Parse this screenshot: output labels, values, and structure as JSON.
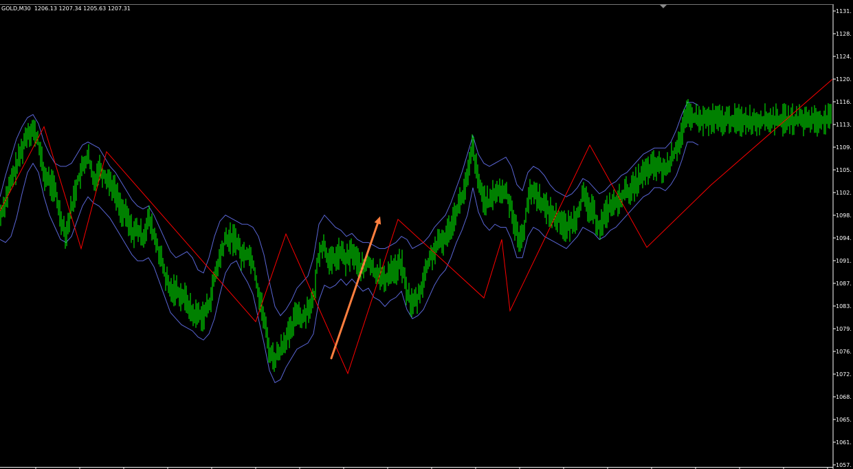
{
  "header": {
    "symbol": "GOLD,M30",
    "ohlc": "1206.13 1207.34 1205.63 1207.31"
  },
  "colors": {
    "background": "#000000",
    "candles": "#00ff00",
    "bands": "#5a66d6",
    "zigzag": "#ff0000",
    "arrow": "#ff7f3f",
    "axis": "#ffffff"
  },
  "chart_data": {
    "type": "line",
    "title": "GOLD,M30",
    "y_axis": {
      "ticks": [
        "1131.",
        "1128.",
        "1124.",
        "1120.",
        "1116.",
        "1113.",
        "1109.",
        "1105.",
        "1102.",
        "1098.",
        "1094.",
        "1091.",
        "1087.",
        "1083.",
        "1079.",
        "1076.",
        "1072.",
        "1068.",
        "1065.",
        "1061.",
        "1057."
      ],
      "ylim": [
        1057,
        1131.5
      ],
      "position": "right"
    },
    "x": [
      0,
      8,
      16,
      24,
      32,
      40,
      48,
      56,
      64,
      72,
      80,
      88,
      96,
      104,
      112,
      120,
      128,
      136,
      144,
      152,
      160,
      168,
      176,
      184,
      192,
      200,
      208,
      216,
      224,
      232,
      240,
      248,
      256,
      264,
      272,
      280,
      288,
      296,
      304,
      312,
      320,
      328,
      336,
      344,
      352,
      360,
      368,
      376,
      384,
      392,
      400,
      408,
      416,
      424,
      432,
      440,
      448,
      456,
      464,
      472,
      480,
      488,
      496,
      504,
      512,
      520,
      528,
      536,
      544,
      552,
      560,
      568,
      576,
      584,
      592,
      600,
      608,
      616,
      624,
      632,
      640,
      648,
      656,
      664,
      672,
      680,
      688,
      696,
      704,
      712,
      720,
      728,
      736,
      744,
      752,
      760,
      768,
      776,
      784,
      792,
      800,
      808,
      816,
      824,
      832,
      840,
      848,
      856,
      864,
      872,
      880,
      888,
      896,
      904,
      912,
      920,
      928,
      936,
      944,
      952,
      960,
      968,
      976,
      984,
      992,
      1000,
      1008,
      1016,
      1024,
      1032,
      1040,
      1048,
      1056,
      1064,
      1072,
      1080,
      1088,
      1096,
      1104,
      1112,
      1120,
      1128,
      1136,
      1144,
      1152,
      1160,
      1168,
      1176,
      1184,
      1192,
      1200,
      1208
    ],
    "series": [
      {
        "kind": "price",
        "values": [
          1097.7,
          1100.5,
          1103.3,
          1106.0,
          1108.8,
          1111.7,
          1112.0,
          1110.0,
          1104.5,
          1103.6,
          1102.1,
          1097.8,
          1094.9,
          1099.1,
          1103.3,
          1105.6,
          1107.9,
          1103.2,
          1105.9,
          1104.5,
          1103.6,
          1101.8,
          1099.0,
          1097.8,
          1095.3,
          1095.5,
          1094.3,
          1097.5,
          1094.6,
          1091.8,
          1088.1,
          1085.4,
          1085.9,
          1084.8,
          1084.0,
          1081.6,
          1081.8,
          1081.5,
          1083.2,
          1087.5,
          1091.0,
          1094.0,
          1094.1,
          1094.0,
          1091.2,
          1092.0,
          1090.4,
          1085.4,
          1081.1,
          1075.6,
          1074.3,
          1076.0,
          1077.9,
          1078.9,
          1082.6,
          1080.8,
          1082.9,
          1083.6,
          1092.2,
          1093.0,
          1090.0,
          1091.0,
          1091.9,
          1090.4,
          1092.1,
          1090.3,
          1089.0,
          1090.5,
          1088.6,
          1088.6,
          1086.9,
          1089.3,
          1088.9,
          1090.2,
          1085.2,
          1083.4,
          1084.3,
          1087.4,
          1090.5,
          1092.3,
          1093.4,
          1094.3,
          1096.4,
          1098.9,
          1100.8,
          1103.9,
          1109.5,
          1103.1,
          1100.8,
          1099.7,
          1101.9,
          1101.7,
          1101.8,
          1099.3,
          1094.9,
          1093.8,
          1100.7,
          1102.0,
          1100.9,
          1099.3,
          1098.6,
          1097.5,
          1097.3,
          1095.7,
          1096.6,
          1098.3,
          1101.1,
          1099.3,
          1098.3,
          1096.0,
          1097.9,
          1099.7,
          1099.6,
          1101.1,
          1101.8,
          1102.2,
          1103.7,
          1104.7,
          1105.4,
          1106.1,
          1105.9,
          1105.2,
          1107.0,
          1109.0,
          1111.6,
          1114.4,
          1114.0,
          1113.6
        ]
      },
      {
        "kind": "upper-band",
        "values": [
          1101.0,
          1104.5,
          1107.5,
          1110.5,
          1112.5,
          1114.0,
          1114.5,
          1113.0,
          1110.0,
          1108.0,
          1106.5,
          1106.0,
          1106.0,
          1106.5,
          1108.0,
          1109.5,
          1110.0,
          1109.5,
          1109.0,
          1107.5,
          1106.0,
          1105.0,
          1103.5,
          1102.0,
          1100.5,
          1099.5,
          1099.0,
          1099.5,
          1098.0,
          1096.0,
          1094.0,
          1092.0,
          1091.0,
          1091.5,
          1092.0,
          1091.0,
          1089.0,
          1088.5,
          1091.0,
          1094.5,
          1097.0,
          1098.0,
          1097.5,
          1097.0,
          1096.5,
          1096.5,
          1096.0,
          1094.5,
          1091.5,
          1087.0,
          1083.0,
          1081.5,
          1082.5,
          1084.0,
          1086.0,
          1087.0,
          1088.0,
          1091.0,
          1096.5,
          1098.0,
          1097.0,
          1096.0,
          1095.5,
          1094.5,
          1095.0,
          1094.0,
          1093.5,
          1093.5,
          1093.0,
          1092.5,
          1092.5,
          1093.0,
          1093.5,
          1094.5,
          1094.0,
          1092.5,
          1093.0,
          1093.5,
          1094.5,
          1096.0,
          1097.0,
          1098.0,
          1100.0,
          1102.5,
          1105.0,
          1108.0,
          1111.0,
          1108.0,
          1106.5,
          1106.0,
          1106.5,
          1107.0,
          1107.5,
          1106.0,
          1103.0,
          1102.0,
          1105.0,
          1106.0,
          1105.5,
          1104.5,
          1103.0,
          1102.0,
          1101.5,
          1101.0,
          1101.5,
          1102.5,
          1104.0,
          1103.5,
          1102.5,
          1101.5,
          1102.0,
          1103.0,
          1103.5,
          1104.5,
          1105.0,
          1106.0,
          1107.0,
          1108.0,
          1108.5,
          1109.0,
          1109.0,
          1109.0,
          1110.0,
          1112.0,
          1114.5,
          1116.5,
          1116.5,
          1116.0
        ]
      },
      {
        "kind": "lower-band",
        "values": [
          1094.0,
          1093.5,
          1094.5,
          1097.5,
          1101.5,
          1105.0,
          1106.5,
          1105.0,
          1101.0,
          1098.0,
          1096.0,
          1094.0,
          1093.5,
          1094.5,
          1097.0,
          1099.5,
          1101.0,
          1100.0,
          1099.5,
          1098.5,
          1097.5,
          1096.0,
          1094.5,
          1093.0,
          1091.5,
          1090.5,
          1090.5,
          1091.0,
          1089.5,
          1087.0,
          1084.5,
          1082.0,
          1081.0,
          1080.0,
          1079.5,
          1079.0,
          1078.0,
          1077.5,
          1078.5,
          1081.0,
          1085.0,
          1088.5,
          1090.0,
          1090.5,
          1088.5,
          1087.0,
          1085.0,
          1081.0,
          1077.0,
          1072.5,
          1070.5,
          1071.0,
          1073.0,
          1074.5,
          1076.0,
          1076.5,
          1077.0,
          1078.5,
          1084.0,
          1086.5,
          1086.0,
          1086.5,
          1087.5,
          1086.5,
          1087.5,
          1086.5,
          1085.5,
          1086.0,
          1084.5,
          1084.0,
          1083.0,
          1084.0,
          1084.5,
          1085.5,
          1082.5,
          1081.0,
          1081.5,
          1082.5,
          1084.5,
          1086.5,
          1088.0,
          1089.0,
          1091.0,
          1093.5,
          1095.5,
          1098.0,
          1102.5,
          1098.5,
          1096.5,
          1095.5,
          1096.5,
          1096.0,
          1096.0,
          1094.0,
          1091.0,
          1091.0,
          1094.5,
          1096.0,
          1095.5,
          1094.5,
          1094.0,
          1093.5,
          1093.0,
          1092.5,
          1093.5,
          1094.5,
          1096.0,
          1095.5,
          1095.0,
          1094.0,
          1094.5,
          1095.5,
          1096.0,
          1097.0,
          1098.0,
          1099.0,
          1100.0,
          1101.0,
          1101.5,
          1102.5,
          1102.5,
          1102.0,
          1103.0,
          1104.5,
          1107.0,
          1110.0,
          1110.0,
          1109.5
        ]
      },
      {
        "kind": "zigzag",
        "points": [
          [
            0,
            1098.7
          ],
          [
            64,
            1112.5
          ],
          [
            118,
            1092.5
          ],
          [
            155,
            1108.4
          ],
          [
            372,
            1080.5
          ],
          [
            416,
            1094.9
          ],
          [
            506,
            1072.0
          ],
          [
            579,
            1097.3
          ],
          [
            704,
            1084.4
          ],
          [
            730,
            1094.0
          ],
          [
            742,
            1082.3
          ],
          [
            858,
            1109.5
          ],
          [
            941,
            1092.7
          ],
          [
            1034,
            1102.9
          ],
          [
            1211,
            1120.3
          ]
        ]
      }
    ],
    "annotations": [
      {
        "type": "arrow",
        "from": [
          482,
          1074.5
        ],
        "to": [
          553,
          1097.8
        ]
      }
    ]
  }
}
